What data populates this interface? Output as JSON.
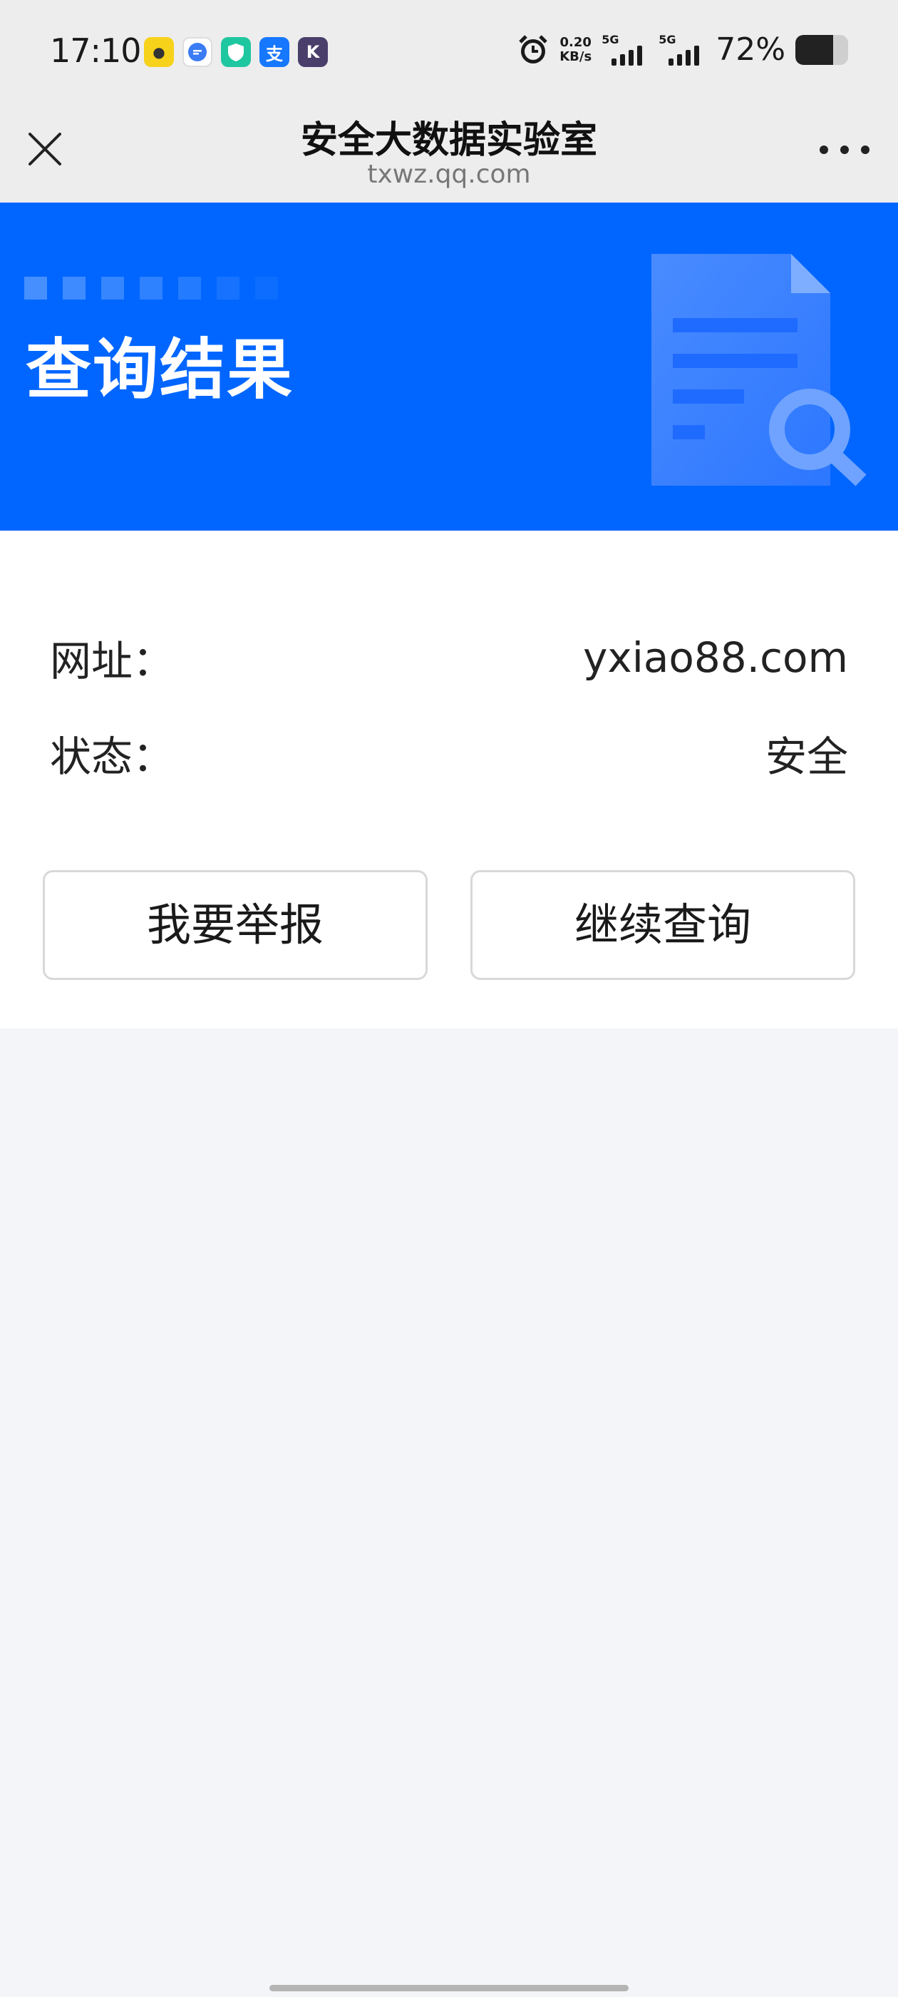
{
  "status_bar": {
    "time": "17:10",
    "net_speed_value": "0.20",
    "net_speed_unit": "KB/s",
    "sim1_label": "5G",
    "sim2_label": "5G",
    "battery_percent_text": "72%",
    "battery_level": 0.72,
    "app_icons": [
      "yellow-app-icon",
      "message-app-icon",
      "shield-app-icon",
      "alipay-icon",
      "k-app-icon"
    ]
  },
  "nav": {
    "title": "安全大数据实验室",
    "subtitle": "txwz.qq.com"
  },
  "banner": {
    "title": "查询结果",
    "bg_color": "#0066ff"
  },
  "result": {
    "url_label": "网址：",
    "url_value": "yxiao88.com",
    "status_label": "状态：",
    "status_value": "安全"
  },
  "actions": {
    "report_label": "我要举报",
    "continue_label": "继续查询"
  }
}
